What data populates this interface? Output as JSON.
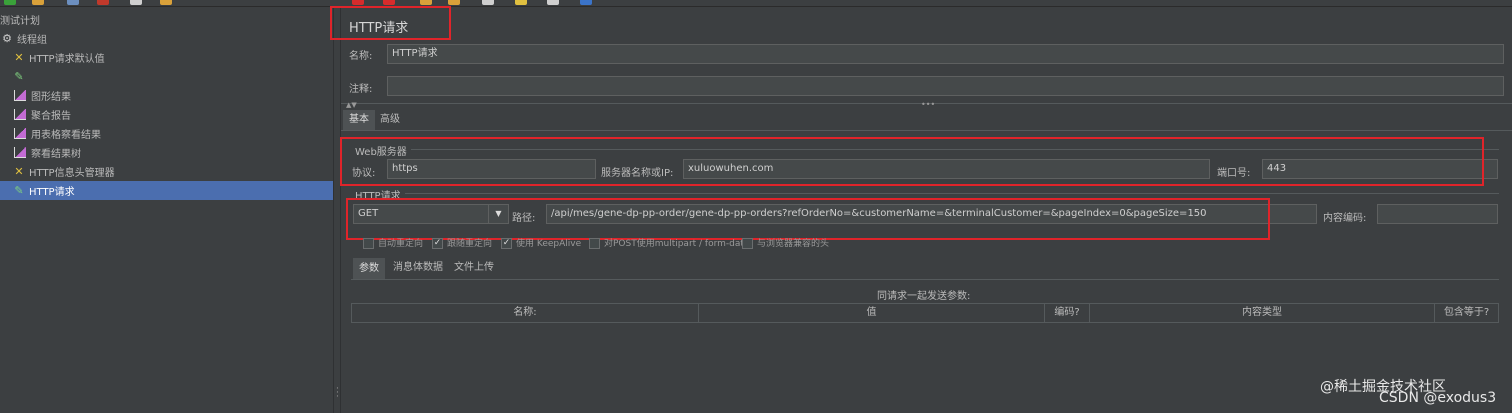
{
  "tree": {
    "items": [
      {
        "label": "测试计划",
        "icon": "none"
      },
      {
        "label": "线程组",
        "icon": "gear-icon"
      },
      {
        "label": "HTTP请求默认值",
        "icon": "wrench-icon"
      },
      {
        "label": "",
        "icon": "dropper-icon"
      },
      {
        "label": "图形结果",
        "icon": "graph-icon"
      },
      {
        "label": "聚合报告",
        "icon": "graph-icon"
      },
      {
        "label": "用表格察看结果",
        "icon": "graph-icon"
      },
      {
        "label": "察看结果树",
        "icon": "graph-icon"
      },
      {
        "label": "HTTP信息头管理器",
        "icon": "wrench-icon"
      },
      {
        "label": "HTTP请求",
        "icon": "dropper-icon"
      }
    ]
  },
  "main": {
    "title": "HTTP请求",
    "name_label": "名称:",
    "name_value": "HTTP请求",
    "comment_label": "注释:",
    "comment_value": "",
    "tabs": {
      "basic": "基本",
      "advanced": "高级"
    },
    "web_server": {
      "section": "Web服务器",
      "protocol_label": "协议:",
      "protocol_value": "https",
      "server_label": "服务器名称或IP:",
      "server_value": "xuluowuhen.com",
      "port_label": "端口号:",
      "port_value": "443"
    },
    "http_request": {
      "section": "HTTP请求",
      "method": "GET",
      "path_label": "路径:",
      "path_value": "/api/mes/gene-dp-pp-order/gene-dp-pp-orders?refOrderNo=&customerName=&terminalCustomer=&pageIndex=0&pageSize=150",
      "encoding_label": "内容编码:",
      "encoding_value": ""
    },
    "options": [
      {
        "label": "自动重定向",
        "checked": false
      },
      {
        "label": "跟随重定向",
        "checked": true
      },
      {
        "label": "使用 KeepAlive",
        "checked": true
      },
      {
        "label": "对POST使用multipart / form-data",
        "checked": false
      },
      {
        "label": "与浏览器兼容的头",
        "checked": false
      }
    ],
    "sub_tabs": {
      "params": "参数",
      "body": "消息体数据",
      "files": "文件上传"
    },
    "params_caption": "同请求一起发送参数:",
    "columns": [
      "名称:",
      "值",
      "编码?",
      "内容类型",
      "包含等于?"
    ]
  },
  "watermark": {
    "line1": "@稀土掘金技术社区",
    "line2": "CSDN @exodus3"
  },
  "colors": {
    "accent": "#4b6eaf",
    "highlight_box": "#e0242a",
    "background": "#3c3f41"
  }
}
